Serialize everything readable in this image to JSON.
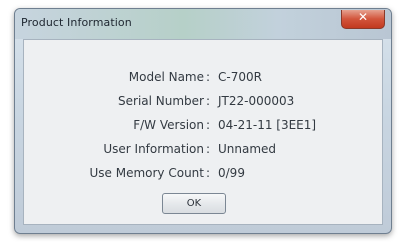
{
  "window": {
    "title": "Product Information",
    "close_glyph": "✕",
    "close_icon": "close-icon"
  },
  "info": {
    "model_name": {
      "label": "Model Name",
      "separator": ":",
      "value": "C-700R"
    },
    "serial_number": {
      "label": "Serial Number",
      "separator": ":",
      "value": "JT22-000003"
    },
    "fw_version": {
      "label": "F/W Version",
      "separator": ":",
      "value": "04-21-11 [3EE1]"
    },
    "user_information": {
      "label": "User Information",
      "separator": ":",
      "value": "Unnamed"
    },
    "use_memory_count": {
      "label": "Use Memory Count",
      "separator": ":",
      "value": "0/99"
    }
  },
  "buttons": {
    "ok_label": "OK"
  }
}
